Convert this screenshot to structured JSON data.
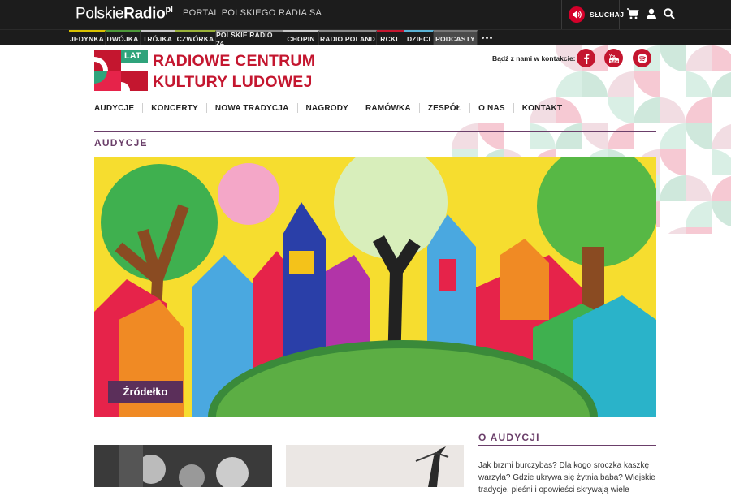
{
  "topbar": {
    "logo_regular": "Polskie",
    "logo_bold": "Radio",
    "logo_sup": "pl",
    "portal_label": "PORTAL POLSKIEGO RADIA SA",
    "listen_label": "SŁUCHAJ",
    "icons": [
      "speaker-icon",
      "cart-icon",
      "user-icon",
      "search-icon"
    ]
  },
  "stations": {
    "items": [
      "JEDYNKA",
      "DWÓJKA",
      "TRÓJKA",
      "CZWÓRKA",
      "POLSKIE RADIO 24",
      "CHOPIN",
      "RADIO POLAND",
      "RCKL",
      "DZIECI",
      "PODCASTY"
    ],
    "more_icon": "more-dots-icon"
  },
  "brand": {
    "badge": "LAT",
    "title_line1": "RADIOWE CENTRUM",
    "title_line2": "KULTURY LUDOWEJ",
    "color": "#c4162f"
  },
  "contact": {
    "label": "Bądź z nami w kontakcie:",
    "social": [
      "facebook-icon",
      "youtube-icon",
      "spotify-icon"
    ]
  },
  "main_nav": {
    "items": [
      "AUDYCJE",
      "KONCERTY",
      "NOWA TRADYCJA",
      "NAGRODY",
      "RAMÓWKA",
      "ZESPÓŁ",
      "O NAS",
      "KONTAKT"
    ]
  },
  "section": {
    "title": "AUDYCJE",
    "accent": "#6b3f6a"
  },
  "hero": {
    "tag": "Źródełko"
  },
  "about": {
    "title": "O AUDYCJI",
    "text": "Jak brzmi burczybas? Dla kogo sroczka kaszkę warzyła? Gdzie ukrywa się żytnia baba? Wiejskie tradycje, pieśni i opowieści skrywają wiele"
  }
}
